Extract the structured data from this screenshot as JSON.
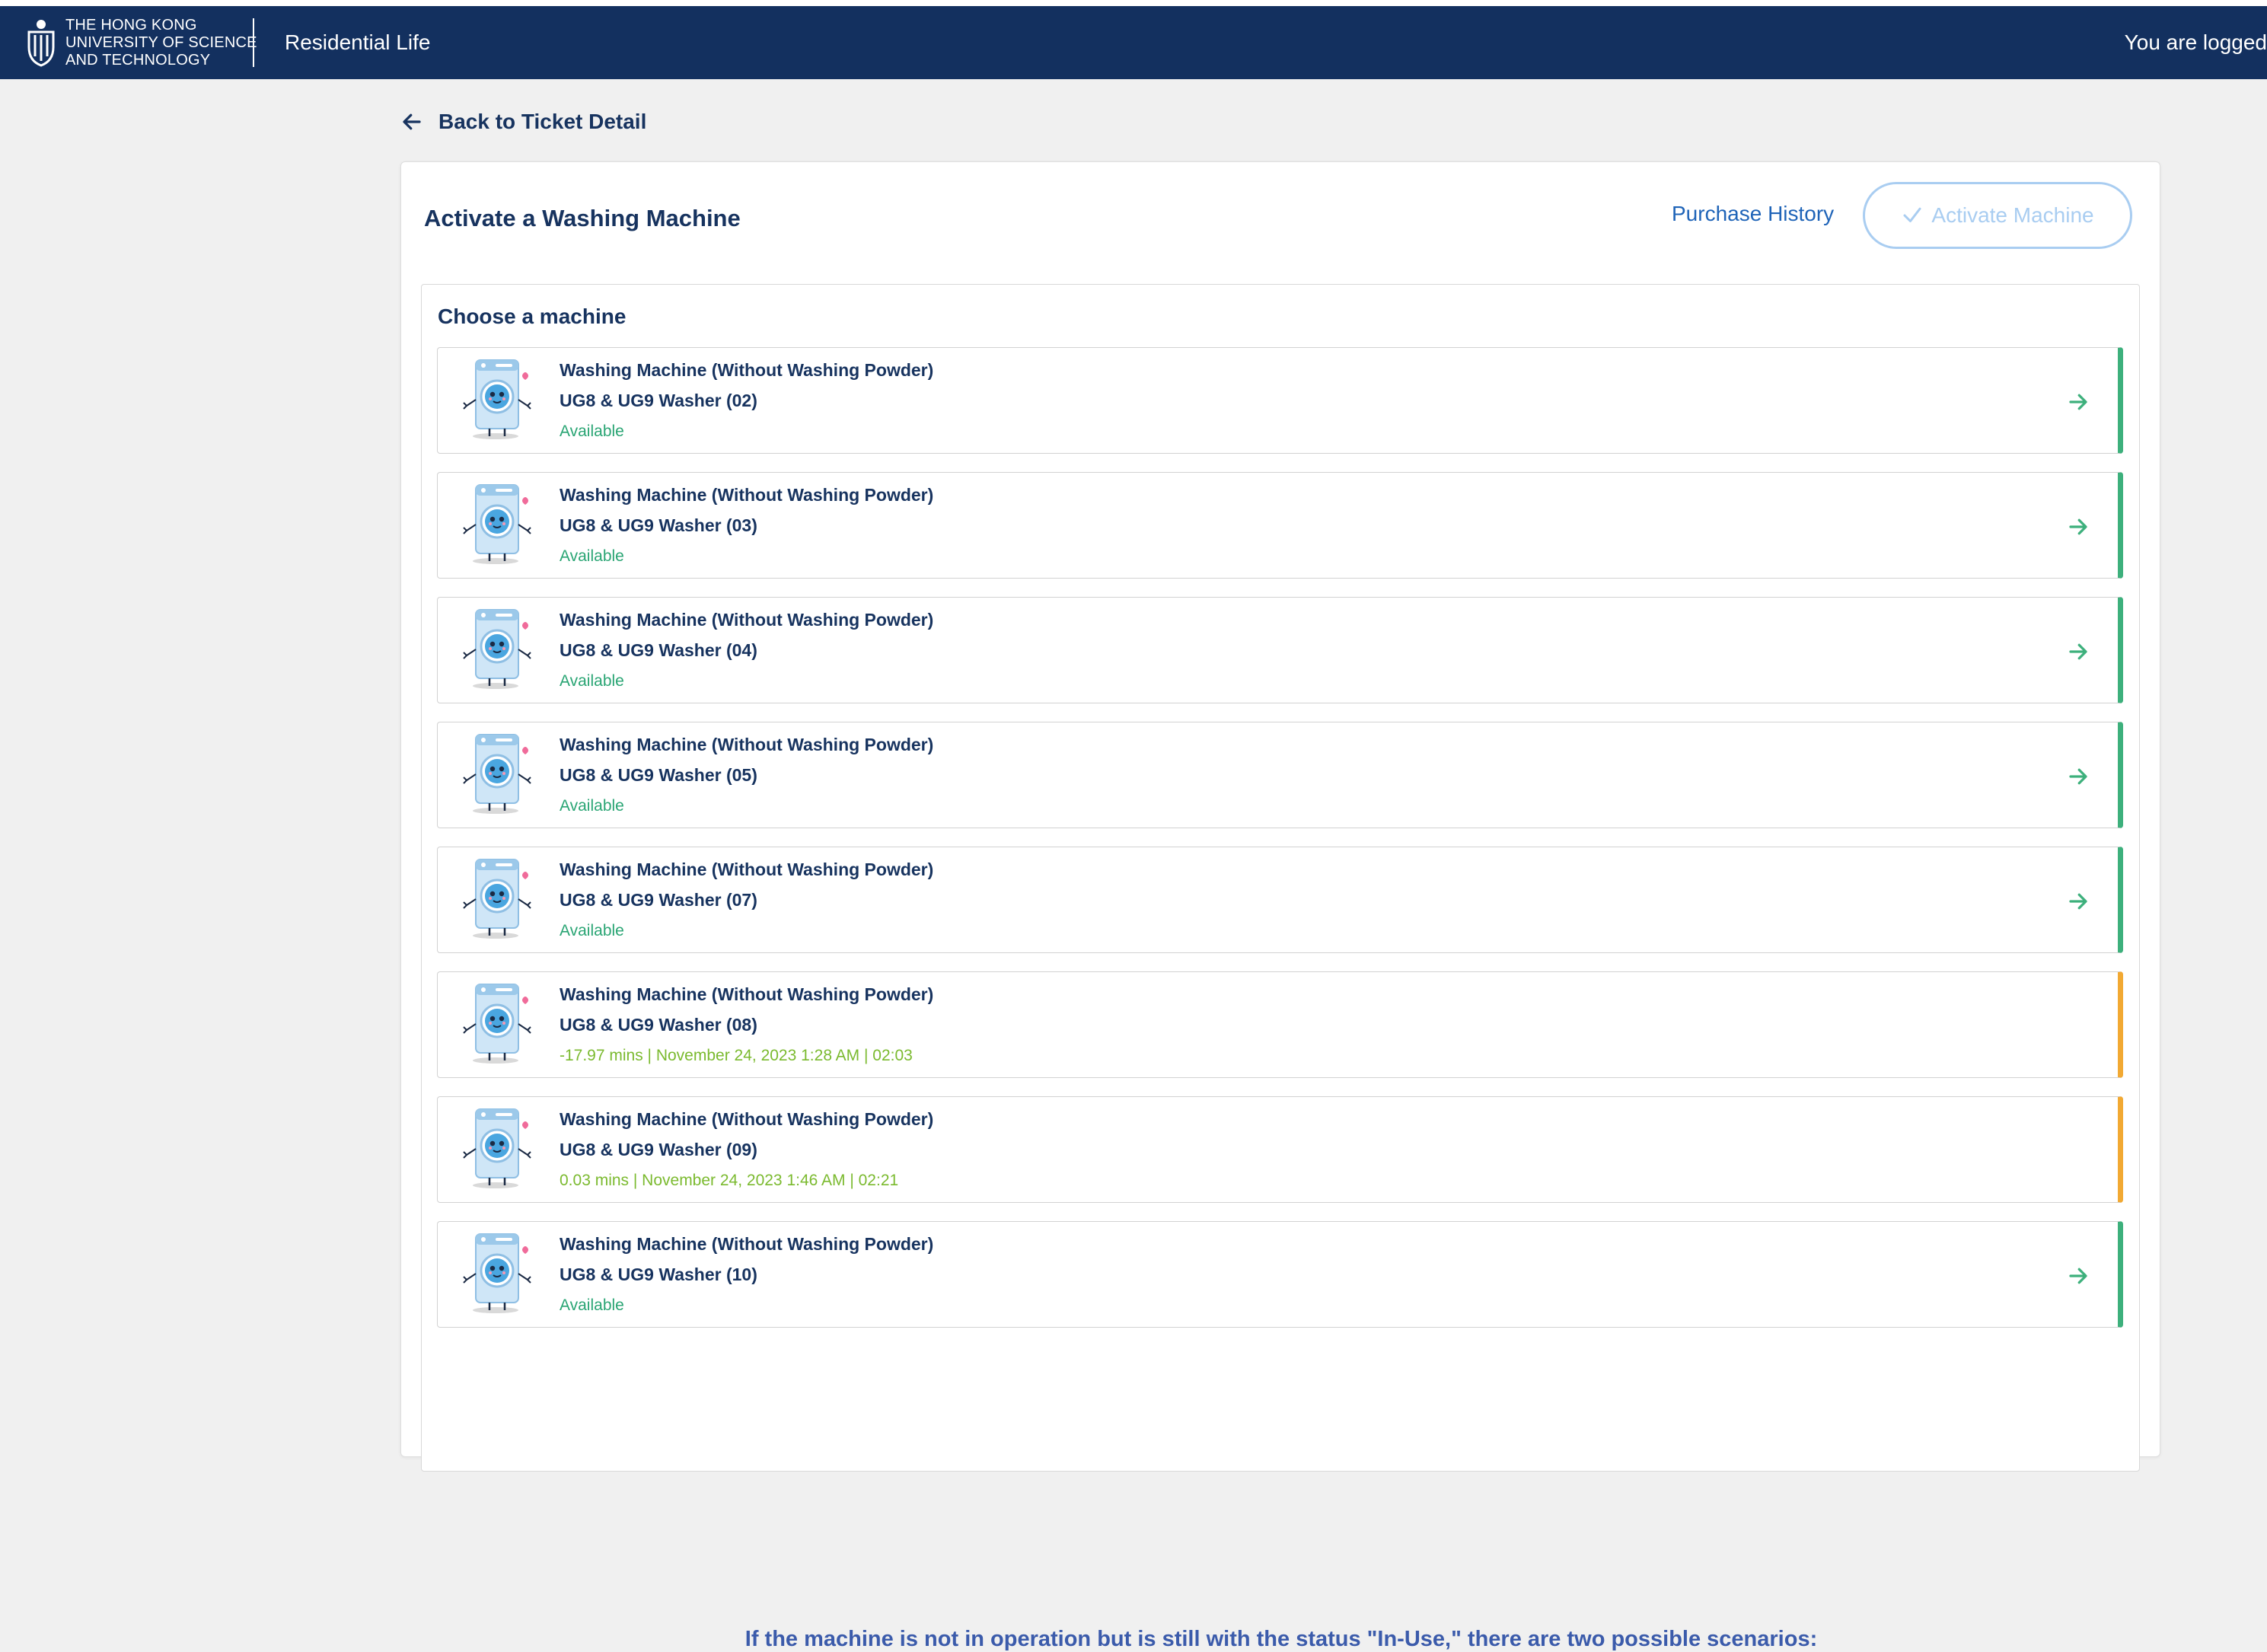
{
  "header": {
    "logo_lines": [
      "The Hong Kong",
      "University of Science",
      "and Technology"
    ],
    "app_title": "Residential Life",
    "user_text": "You are logged"
  },
  "back_link": {
    "label": "Back to Ticket Detail",
    "icon": "arrow-left-icon"
  },
  "card": {
    "title": "Activate a Washing Machine",
    "purchase_history": "Purchase History",
    "activate_button": "Activate Machine",
    "activate_icon": "check-icon"
  },
  "machines": {
    "heading": "Choose a machine",
    "items": [
      {
        "type": "Washing Machine (Without Washing Powder)",
        "name": "UG8 & UG9 Washer (02)",
        "status": "Available",
        "state": "available"
      },
      {
        "type": "Washing Machine (Without Washing Powder)",
        "name": "UG8 & UG9 Washer (03)",
        "status": "Available",
        "state": "available"
      },
      {
        "type": "Washing Machine (Without Washing Powder)",
        "name": "UG8 & UG9 Washer (04)",
        "status": "Available",
        "state": "available"
      },
      {
        "type": "Washing Machine (Without Washing Powder)",
        "name": "UG8 & UG9 Washer (05)",
        "status": "Available",
        "state": "available"
      },
      {
        "type": "Washing Machine (Without Washing Powder)",
        "name": "UG8 & UG9 Washer (07)",
        "status": "Available",
        "state": "available"
      },
      {
        "type": "Washing Machine (Without Washing Powder)",
        "name": "UG8 & UG9 Washer (08)",
        "status": "-17.97 mins | November 24, 2023 1:28 AM | 02:03",
        "state": "in-use"
      },
      {
        "type": "Washing Machine (Without Washing Powder)",
        "name": "UG8 & UG9 Washer (09)",
        "status": "0.03 mins | November 24, 2023 1:46 AM | 02:21",
        "state": "in-use"
      },
      {
        "type": "Washing Machine (Without Washing Powder)",
        "name": "UG8 & UG9 Washer (10)",
        "status": "Available",
        "state": "available"
      }
    ]
  },
  "note": "If the machine is not in operation but is still with the status \"In-Use,\" there are two possible scenarios:",
  "colors": {
    "header_bg": "#13305f",
    "available": "#3db07c",
    "in_use": "#f2a933",
    "link": "#1f64b8"
  }
}
